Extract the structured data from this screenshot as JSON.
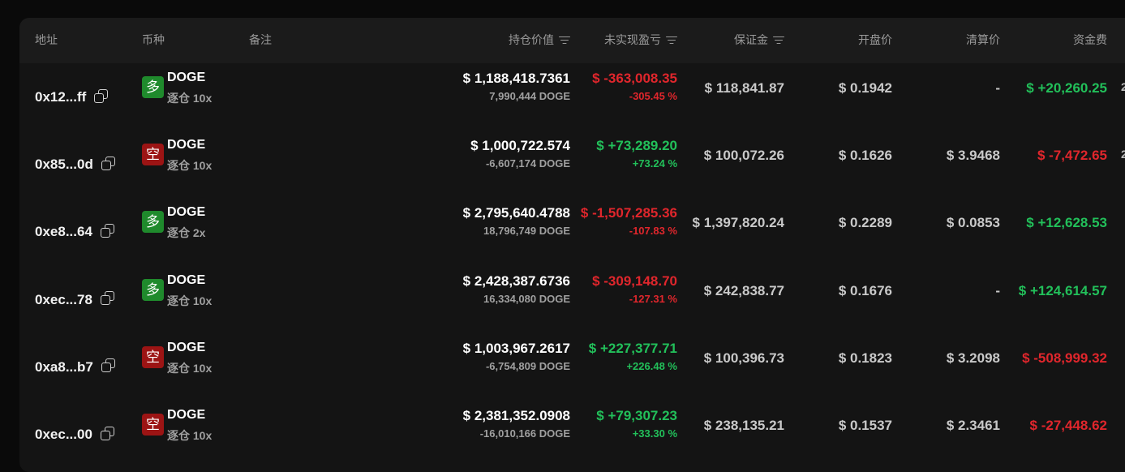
{
  "columns": {
    "address": "地址",
    "coin": "币种",
    "note": "备注",
    "position_value": "持仓价值",
    "unrealized_pnl": "未实现盈亏",
    "margin": "保证金",
    "entry_price": "开盘价",
    "liq_price": "清算价",
    "funding": "资金费"
  },
  "rows": [
    {
      "address": "0x12...ff",
      "side": "多",
      "side_type": "long",
      "coin": "DOGE",
      "mode": "逐仓 10x",
      "value": "$ 1,188,418.7361",
      "qty": "7,990,444 DOGE",
      "pnl": "$ -363,008.35",
      "pnl_pct": "-305.45 %",
      "pnl_color": "red",
      "margin": "$ 118,841.87",
      "entry": "$ 0.1942",
      "liq": "-",
      "funding": "$ +20,260.25",
      "funding_color": "green",
      "edge": "2"
    },
    {
      "address": "0x85...0d",
      "side": "空",
      "side_type": "short",
      "coin": "DOGE",
      "mode": "逐仓 10x",
      "value": "$ 1,000,722.574",
      "qty": "-6,607,174 DOGE",
      "pnl": "$ +73,289.20",
      "pnl_pct": "+73.24 %",
      "pnl_color": "green",
      "margin": "$ 100,072.26",
      "entry": "$ 0.1626",
      "liq": "$ 3.9468",
      "funding": "$ -7,472.65",
      "funding_color": "red",
      "edge": "2"
    },
    {
      "address": "0xe8...64",
      "side": "多",
      "side_type": "long",
      "coin": "DOGE",
      "mode": "逐仓 2x",
      "value": "$ 2,795,640.4788",
      "qty": "18,796,749 DOGE",
      "pnl": "$ -1,507,285.36",
      "pnl_pct": "-107.83 %",
      "pnl_color": "red",
      "margin": "$ 1,397,820.24",
      "entry": "$ 0.2289",
      "liq": "$ 0.0853",
      "funding": "$ +12,628.53",
      "funding_color": "green",
      "edge": ""
    },
    {
      "address": "0xec...78",
      "side": "多",
      "side_type": "long",
      "coin": "DOGE",
      "mode": "逐仓 10x",
      "value": "$ 2,428,387.6736",
      "qty": "16,334,080 DOGE",
      "pnl": "$ -309,148.70",
      "pnl_pct": "-127.31 %",
      "pnl_color": "red",
      "margin": "$ 242,838.77",
      "entry": "$ 0.1676",
      "liq": "-",
      "funding": "$ +124,614.57",
      "funding_color": "green",
      "edge": ""
    },
    {
      "address": "0xa8...b7",
      "side": "空",
      "side_type": "short",
      "coin": "DOGE",
      "mode": "逐仓 10x",
      "value": "$ 1,003,967.2617",
      "qty": "-6,754,809 DOGE",
      "pnl": "$ +227,377.71",
      "pnl_pct": "+226.48 %",
      "pnl_color": "green",
      "margin": "$ 100,396.73",
      "entry": "$ 0.1823",
      "liq": "$ 3.2098",
      "funding": "$ -508,999.32",
      "funding_color": "red",
      "edge": ""
    },
    {
      "address": "0xec...00",
      "side": "空",
      "side_type": "short",
      "coin": "DOGE",
      "mode": "逐仓 10x",
      "value": "$ 2,381,352.0908",
      "qty": "-16,010,166 DOGE",
      "pnl": "$ +79,307.23",
      "pnl_pct": "+33.30 %",
      "pnl_color": "green",
      "margin": "$ 238,135.21",
      "entry": "$ 0.1537",
      "liq": "$ 2.3461",
      "funding": "$ -27,448.62",
      "funding_color": "red",
      "edge": ""
    }
  ]
}
